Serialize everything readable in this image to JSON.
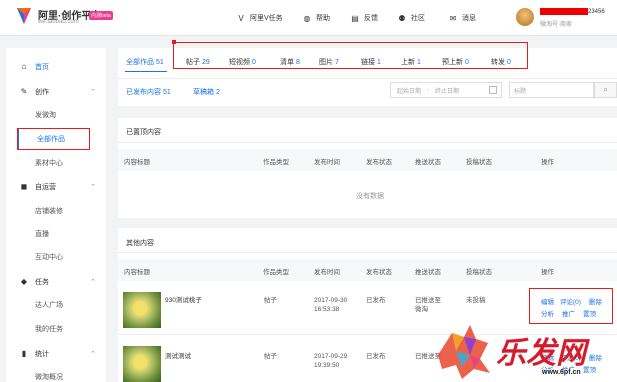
{
  "header": {
    "logo_title": "阿里·创作平台",
    "logo_url": "we.taobao.com",
    "beta": "内测beta",
    "nav": [
      {
        "icon": "v-icon",
        "label": "阿里V任务"
      },
      {
        "icon": "help-icon",
        "label": "帮助"
      },
      {
        "icon": "feedback-icon",
        "label": "反馈"
      },
      {
        "icon": "community-icon",
        "label": "社区"
      },
      {
        "icon": "mail-icon",
        "label": "消息"
      }
    ],
    "user_suffix": "23456",
    "user_sub": "微淘号·商家"
  },
  "sidebar": {
    "items": [
      {
        "label": "首页",
        "type": "section",
        "icon": "home-icon"
      },
      {
        "label": "创作",
        "type": "section",
        "icon": "pen-icon"
      },
      {
        "label": "发微淘",
        "type": "sub"
      },
      {
        "label": "全部作品",
        "type": "sub",
        "active": true
      },
      {
        "label": "素材中心",
        "type": "sub"
      },
      {
        "label": "自运营",
        "type": "section",
        "icon": "box-icon"
      },
      {
        "label": "店铺装修",
        "type": "sub"
      },
      {
        "label": "直播",
        "type": "sub"
      },
      {
        "label": "互动中心",
        "type": "sub"
      },
      {
        "label": "任务",
        "type": "section",
        "icon": "task-icon"
      },
      {
        "label": "达人广场",
        "type": "sub"
      },
      {
        "label": "我的任务",
        "type": "sub"
      },
      {
        "label": "统计",
        "type": "section",
        "icon": "chart-icon"
      },
      {
        "label": "微淘概况",
        "type": "sub"
      }
    ]
  },
  "tabs": [
    {
      "label": "全部作品",
      "count": "51"
    },
    {
      "label": "帖子",
      "count": "29"
    },
    {
      "label": "短视频",
      "count": "0"
    },
    {
      "label": "清单",
      "count": "8"
    },
    {
      "label": "图片",
      "count": "7"
    },
    {
      "label": "链接",
      "count": "1"
    },
    {
      "label": "上新",
      "count": "1"
    },
    {
      "label": "预上新",
      "count": "0"
    },
    {
      "label": "转发",
      "count": "0"
    }
  ],
  "subtabs": {
    "published": "已发布内容 51",
    "drafts": "草稿箱 2"
  },
  "filters": {
    "start_date": "起始日期",
    "sep": "-",
    "end_date": "终止日期",
    "title_placeholder": "标题"
  },
  "table_headers": [
    "内容标题",
    "作品类型",
    "发布时间",
    "发布状态",
    "推送状态",
    "投稿状态",
    "操作"
  ],
  "sections": {
    "pinned": "已置顶内容",
    "others": "其他内容",
    "empty": "没有数据"
  },
  "rows": [
    {
      "title": "930测试桃子",
      "type": "帖子",
      "date": "2017-09-30",
      "time": "16:53:38",
      "status": "已发布",
      "push1": "已推送至",
      "push2": "微淘",
      "submit": "未投稿",
      "actions_line1": [
        "编辑",
        "评论(0)",
        "删除"
      ],
      "actions_line2": [
        "分析",
        "推广",
        "置顶"
      ]
    },
    {
      "title": "测试测试",
      "type": "帖子",
      "date": "2017-09-29",
      "time": "19:39:50",
      "status": "已发布",
      "push1": "已推送至",
      "push2": "",
      "submit": "",
      "actions_line1": [
        "编辑",
        "评论(0)",
        "删除"
      ],
      "actions_line2": [
        "分析",
        "推广",
        "置顶"
      ]
    }
  ],
  "watermark": "乐发网",
  "watermark_url": "www.6pf.cn",
  "colors": {
    "accent": "#1a73e8",
    "highlight": "#e02020"
  }
}
